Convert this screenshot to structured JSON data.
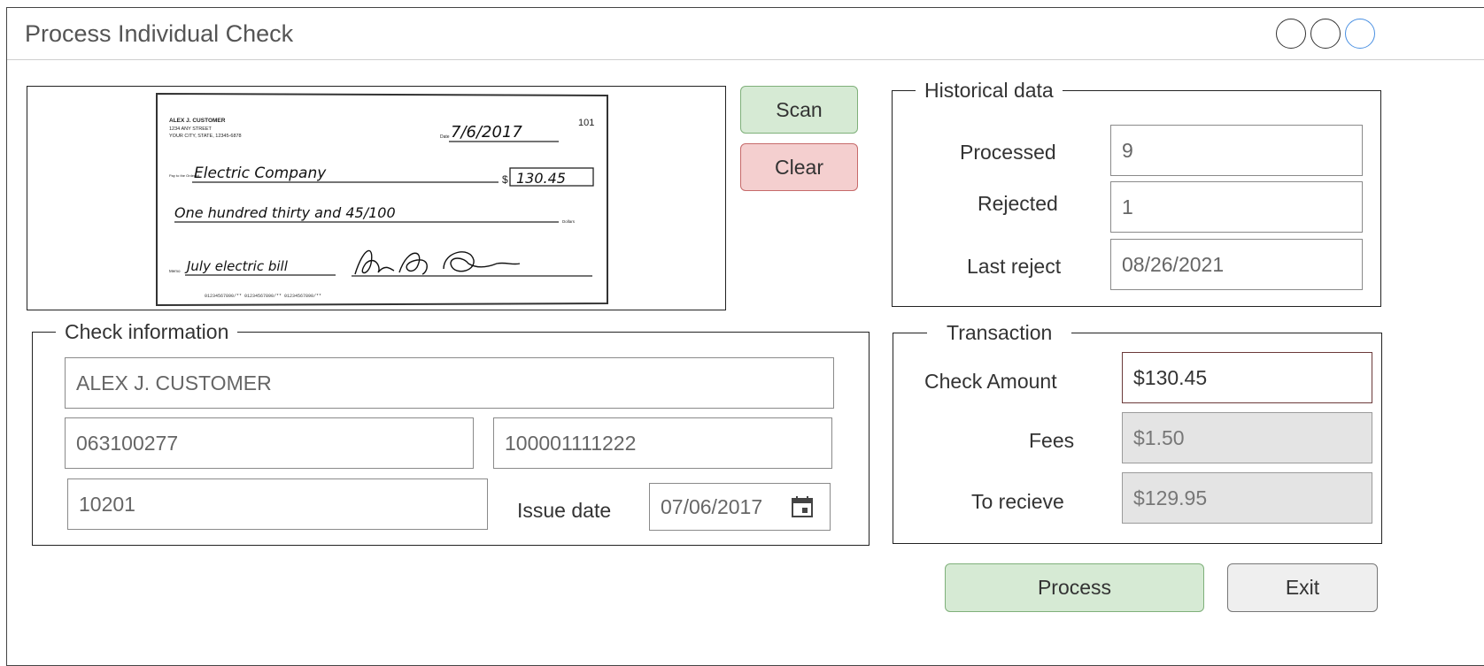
{
  "window": {
    "title": "Process Individual Check"
  },
  "check_image": {
    "customer_name": "ALEX J. CUSTOMER",
    "address_line1": "1234 ANY STREET",
    "address_line2": "YOUR CITY, STATE, 12345-6878",
    "check_number": "101",
    "date_label": "Date",
    "date": "7/6/2017",
    "payee_label": "Pay to the Order of",
    "payee": "Electric Company",
    "dollar_sign": "$",
    "amount": "130.45",
    "amount_words": "One hundred thirty and 45/100",
    "dollars_label": "Dollars",
    "memo_label": "Memo",
    "memo": "July electric bill",
    "signature": "Alex J. Customer",
    "micr_line": "01234567890/** 01234567890/** 01234567890/**"
  },
  "buttons": {
    "scan": "Scan",
    "clear": "Clear",
    "process": "Process",
    "exit": "Exit"
  },
  "historical": {
    "legend": "Historical data",
    "processed_label": "Processed",
    "processed_value": "9",
    "rejected_label": "Rejected",
    "rejected_value": "1",
    "last_reject_label": "Last reject",
    "last_reject_value": "08/26/2021"
  },
  "check_info": {
    "legend": "Check information",
    "name": "ALEX J. CUSTOMER",
    "routing": "063100277",
    "account": "100001111222",
    "check_number": "10201",
    "issue_date_label": "Issue date",
    "issue_date": "07/06/2017"
  },
  "transaction": {
    "legend": "Transaction",
    "check_amount_label": "Check Amount",
    "check_amount": "$130.45",
    "fees_label": "Fees",
    "fees": "$1.50",
    "to_receive_label": "To recieve",
    "to_receive": "$129.95"
  },
  "colors": {
    "scan_bg": "#d6ead4",
    "clear_bg": "#f4cfcf",
    "process_bg": "#d6ead4",
    "exit_bg": "#efefef",
    "disabled_field_bg": "#e4e4e4",
    "maximize_accent": "#4a90e2"
  },
  "icons": {
    "calendar": "calendar-icon",
    "minimize": "minimize-button",
    "restore": "restore-button",
    "close": "close-button"
  }
}
